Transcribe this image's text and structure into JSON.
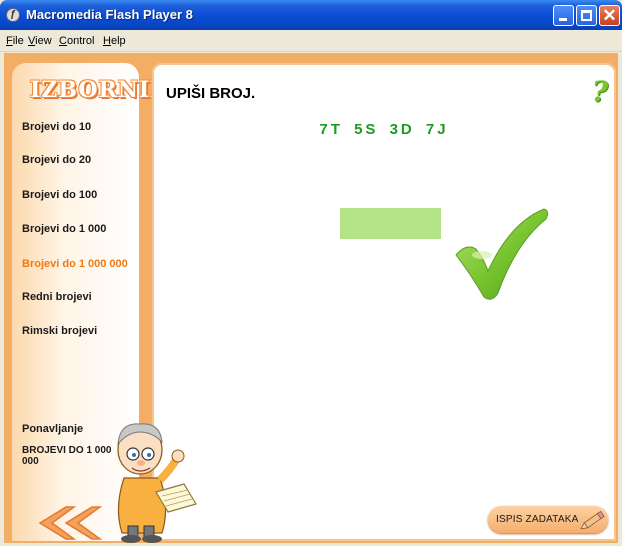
{
  "window": {
    "title": "Macromedia Flash Player 8",
    "icon_name": "flash-player-icon"
  },
  "menubar": {
    "items": [
      "File",
      "View",
      "Control",
      "Help"
    ]
  },
  "sidebar": {
    "heading": "IZBORNIK",
    "items": [
      {
        "label": "Brojevi do 10",
        "active": false
      },
      {
        "label": "Brojevi do 20",
        "active": false
      },
      {
        "label": "Brojevi do 100",
        "active": false
      },
      {
        "label": "Brojevi do 1 000",
        "active": false
      },
      {
        "label": "Brojevi do 1 000 000",
        "active": true
      },
      {
        "label": "Redni brojevi",
        "active": false
      },
      {
        "label": "Rimski brojevi",
        "active": false
      }
    ],
    "review_label": "Ponavljanje",
    "review_topic": "BROJEVI DO 1 000 000",
    "back_icon": "double-chevron-left-icon"
  },
  "main": {
    "task_title": "UPIŠI BROJ.",
    "number_description": "7T 5S 3D 7J",
    "answer_value": "",
    "result_icon": "checkmark-icon",
    "help_icon": "question-mark-icon",
    "help_symbol": "?",
    "print_button_label": "ISPIS ZADATAKA"
  },
  "colors": {
    "stage_orange": "#f3ad64",
    "active_menu": "#f07a12",
    "number_green": "#1e9a22",
    "answer_field": "#b3e386",
    "check_green": "#7ac631"
  }
}
